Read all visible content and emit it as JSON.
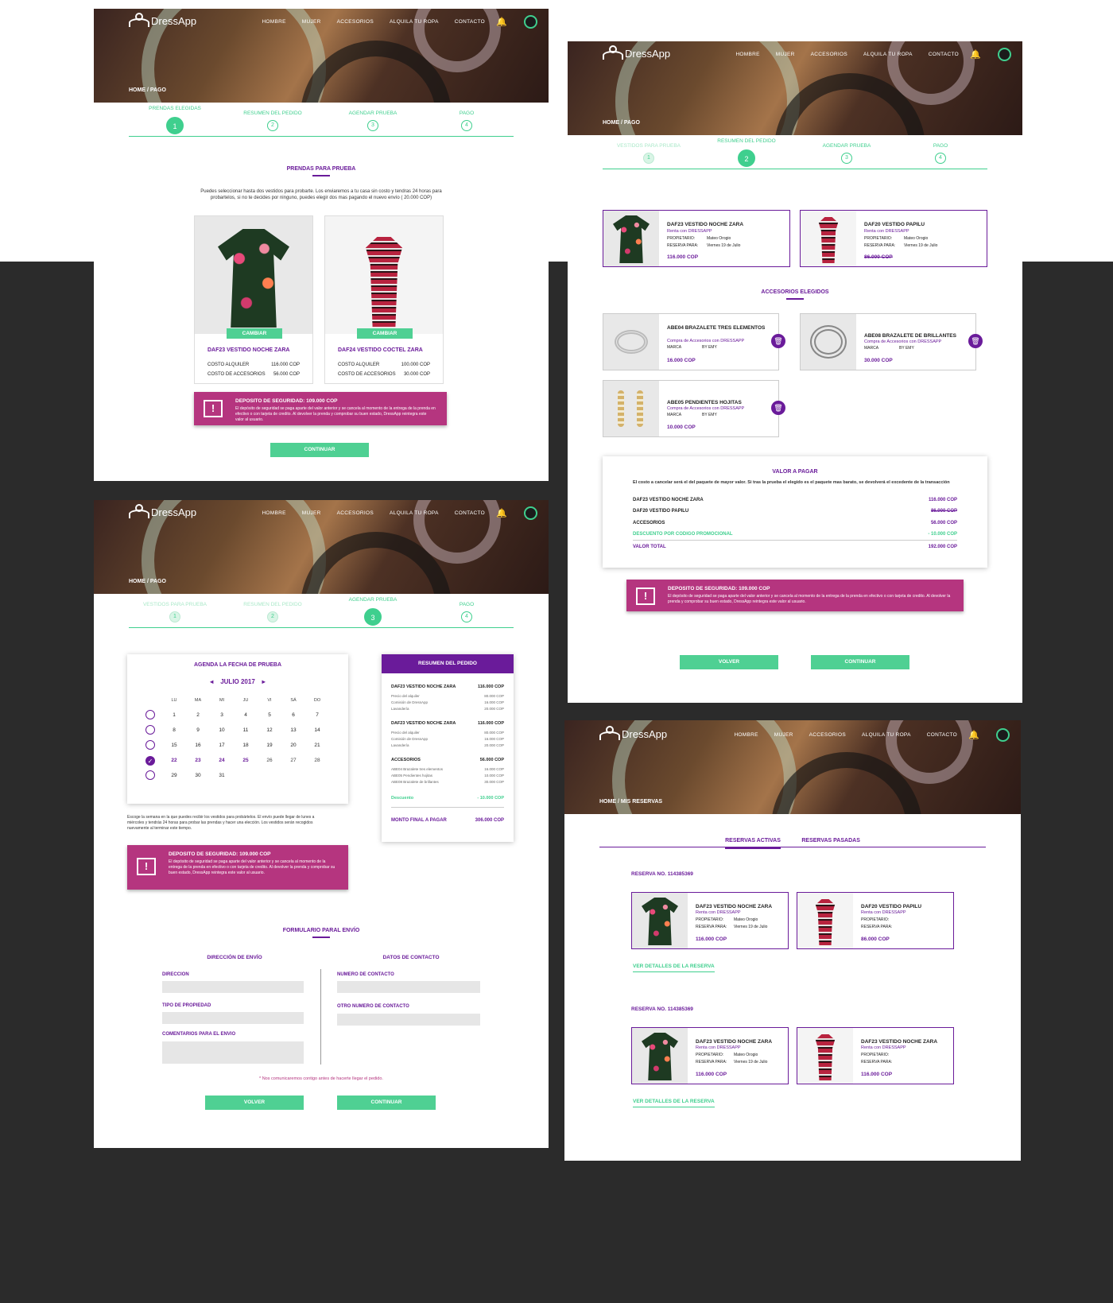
{
  "app": {
    "name": "DressApp",
    "nav": [
      "HOMBRE",
      "MUJER",
      "ACCESORIOS",
      "ALQUILA TU ROPA",
      "CONTACTO"
    ],
    "accent": "#3fcf8e",
    "brand": "#6a1b9a",
    "alert": "#b5357f"
  },
  "steps": [
    "PRENDAS ELEGIDAS",
    "RESUMEN DEL PEDIDO",
    "AGENDAR PRUEBA",
    "PAGO"
  ],
  "steps_alt": [
    "VESTIDOS PARA PRUEBA",
    "RESUMEN DEL PEDIDO",
    "AGENDAR PRUEBA",
    "PAGO"
  ],
  "deposit": {
    "title": "DEPOSITO DE SEGURIDAD:  109.000 COP",
    "text": "El depósito de seguridad se paga aparte del valor anterior y se cancela al momento de la entrega de la prenda en efectivo o con tarjeta de credito. Al devolver la prenda y comprobar su buen estado, DressApp reintegra este valor al usuario."
  },
  "p1": {
    "crumb": "HOME / PAGO",
    "section": "PRENDAS PARA PRUEBA",
    "intro": "Puedes seleccionar hasta dos vestidos para probarte. Los enviaremos a tu casa sin costo y tendras 24 horas para probartelos, si no te decides por ninguno, puedes elegir dos mas pagando el nuevo envío ( 20.000 COP)",
    "change": "CAMBIAR",
    "rent_label": "COSTO ALQUILER",
    "acc_label": "COSTO DE ACCESORIOS",
    "items": [
      {
        "name": "DAF23 VESTIDO NOCHE ZARA",
        "rent": "116.000 COP",
        "acc": "56.000 COP"
      },
      {
        "name": "DAF24 VESTIDO COCTEL ZARA",
        "rent": "100.000 COP",
        "acc": "30.000 COP"
      }
    ],
    "continue": "CONTINUAR"
  },
  "p2": {
    "crumb": "HOME / PAGO",
    "dresses": [
      {
        "name": "DAF23 VESTIDO NOCHE ZARA",
        "sub": "Renta con DRESSAPP",
        "owner_k": "PROPIETARIO:",
        "owner_v": "Mateo Orogio",
        "res_k": "RESERVA PARA:",
        "res_v": "Viernes 19 de Julio",
        "price": "116.000 COP"
      },
      {
        "name": "DAF20 VESTIDO PAPILU",
        "sub": "Renta con DRESSAPP",
        "owner_k": "PROPIETARIO:",
        "owner_v": "Mateo Orogio",
        "res_k": "RESERVA PARA:",
        "res_v": "Viernes 19 de Julio",
        "price": "86.000 COP"
      }
    ],
    "acc_title": "ACCESORIOS ELEGIDOS",
    "accessories": [
      {
        "name": "ABE04 BRAZALETE TRES ELEMENTOS",
        "sub": "Compra de Accesorios con DRESSAPP",
        "brand_k": "MARCA",
        "brand_v": "BY EMY",
        "price": "16.000 COP"
      },
      {
        "name": "ABE08 BRAZALETE DE BRILLANTES",
        "sub": "Compra de Accesorios con DRESSAPP",
        "brand_k": "MARCA",
        "brand_v": "BY EMY",
        "price": "30.000 COP"
      },
      {
        "name": "ABE05 PENDIENTES HOJITAS",
        "sub": "Compra de Accesorios con DRESSAPP",
        "brand_k": "MARCA",
        "brand_v": "BY EMY",
        "price": "10.000 COP"
      }
    ],
    "pay": {
      "title": "VALOR A PAGAR",
      "note": "El costo a cancelar será el del paquete de mayor valor. Si tras la prueba el elegido es el paquete mas barato, se devolverá el excedente de la transacción",
      "rows": [
        {
          "k": "DAF23 VESTIDO NOCHE ZARA",
          "v": "116.000 COP"
        },
        {
          "k": "DAF20 VESTIDO PAPILU",
          "v": "86.000 COP"
        },
        {
          "k": "ACCESORIOS",
          "v": "56.000 COP"
        },
        {
          "k": "DESCUENTO POR CODIGO PROMOCIONAL",
          "v": "- 10.000 COP"
        },
        {
          "k": "VALOR TOTAL",
          "v": "192.000 COP"
        }
      ]
    },
    "back": "VOLVER",
    "continue": "CONTINUAR"
  },
  "p3": {
    "crumb": "HOME / PAGO",
    "cal_title": "AGENDA LA FECHA DE PRUEBA",
    "month": "JULIO 2017",
    "days": [
      "LU",
      "MA",
      "MI",
      "JU",
      "VI",
      "SÁ",
      "DO"
    ],
    "weeks": [
      [
        "1",
        "2",
        "3",
        "4",
        "5",
        "6",
        "7"
      ],
      [
        "8",
        "9",
        "10",
        "11",
        "12",
        "13",
        "14"
      ],
      [
        "15",
        "16",
        "17",
        "18",
        "19",
        "20",
        "21"
      ],
      [
        "22",
        "23",
        "24",
        "25",
        "26",
        "27",
        "28"
      ],
      [
        "29",
        "30",
        "31",
        "",
        "",
        "",
        ""
      ]
    ],
    "cal_note": "Escoge la semana en la que puedes recibir los vestidos para probártelos. El envío puede llegar de lunes a miércoles y tendrás 24 horas para probar las prendas y hacer una elección. Los vestidos serán recogidos nuevamente al terminar este tiempo.",
    "summary": {
      "title": "RESUMEN DEL PEDIDO",
      "blocks": [
        {
          "head": "DAF23 VESTIDO NOCHE ZARA",
          "head_v": "116.000 COP",
          "lines": [
            {
              "k": "Precio del alquiler",
              "v": "80.000 COP"
            },
            {
              "k": "Comisión de DressApp",
              "v": "16.000 COP"
            },
            {
              "k": "Lavandería",
              "v": "20.000 COP"
            }
          ]
        },
        {
          "head": "DAF23 VESTIDO NOCHE ZARA",
          "head_v": "116.000 COP",
          "lines": [
            {
              "k": "Precio del alquiler",
              "v": "80.000 COP"
            },
            {
              "k": "Comisión de DressApp",
              "v": "16.000 COP"
            },
            {
              "k": "Lavandería",
              "v": "20.000 COP"
            }
          ]
        },
        {
          "head": "ACCESORIOS",
          "head_v": "56.000 COP",
          "lines": [
            {
              "k": "ABE04 Brazalete tres elementos",
              "v": "16.000 COP"
            },
            {
              "k": "ABE05 Pendientes hojitas",
              "v": "10.000 COP"
            },
            {
              "k": "ABE08 Brazalete de brillantes",
              "v": "30.000 COP"
            }
          ]
        }
      ],
      "discount_k": "Descuento",
      "discount_v": "- 10.000 COP",
      "total_k": "MONTO FINAL A PAGAR",
      "total_v": "306.000 COP"
    },
    "form_title": "FORMULARIO PARAL ENVÍO",
    "addr_title": "DIRECCIÓN DE ENVÍO",
    "contact_title": "DATOS DE CONTACTO",
    "f_dir": "DIRECCION",
    "f_tipo": "TIPO DE PROPIEDAD",
    "f_com": "COMENTARIOS PARA EL ENVIO",
    "f_num": "NUMERO DE CONTACTO",
    "f_otro": "OTRO NUMERO DE CONTACTO",
    "footnote": "* Nos comunicaremos contigo antes de hacerte llegar el pedido.",
    "back": "VOLVER",
    "continue": "CONTINUAR"
  },
  "p4": {
    "crumb": "HOME / MIS RESERVAS",
    "tab_active": "RESERVAS ACTIVAS",
    "tab_past": "RESERVAS PASADAS",
    "reservations": [
      {
        "title": "RESERVA NO. 114385369",
        "items": [
          {
            "name": "DAF23 VESTIDO NOCHE ZARA",
            "sub": "Renta con DRESSAPP",
            "owner_k": "PROPIETARIO:",
            "owner_v": "Mateo Orogio",
            "res_k": "RESERVA PARA:",
            "res_v": "Viernes 19 de Julio",
            "price": "116.000 COP"
          },
          {
            "name": "DAF20 VESTIDO PAPILU",
            "sub": "Renta con DRESSAPP",
            "owner_k": "PROPIETARIO:",
            "owner_v": "",
            "res_k": "RESERVA PARA:",
            "res_v": "",
            "price": "86.000 COP"
          }
        ]
      },
      {
        "title": "RESERVA NO. 114385369",
        "items": [
          {
            "name": "DAF23 VESTIDO NOCHE ZARA",
            "sub": "Renta con DRESSAPP",
            "owner_k": "PROPIETARIO:",
            "owner_v": "Mateo Orogio",
            "res_k": "RESERVA PARA:",
            "res_v": "Viernes 19 de Julio",
            "price": "116.000 COP"
          },
          {
            "name": "DAF23 VESTIDO NOCHE ZARA",
            "sub": "Renta con DRESSAPP",
            "owner_k": "PROPIETARIO:",
            "owner_v": "",
            "res_k": "RESERVA PARA:",
            "res_v": "",
            "price": "116.000 COP"
          }
        ]
      }
    ],
    "details": "VER DETALLES DE LA RESERVA"
  }
}
